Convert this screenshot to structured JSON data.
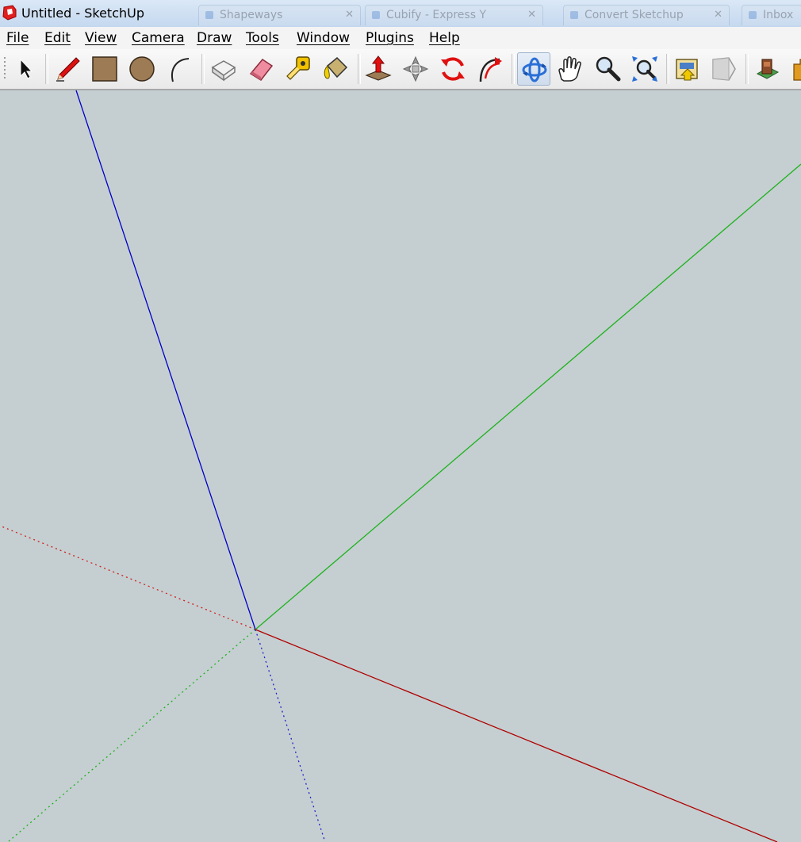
{
  "window": {
    "title": "Untitled - SketchUp",
    "background_tabs": [
      {
        "label": "Shapeways"
      },
      {
        "label": "Cubify - Express Y"
      },
      {
        "label": "Convert Sketchup"
      },
      {
        "label": "Inbox"
      }
    ]
  },
  "menu": {
    "items": [
      {
        "label": "File"
      },
      {
        "label": "Edit"
      },
      {
        "label": "View"
      },
      {
        "label": "Camera"
      },
      {
        "label": "Draw"
      },
      {
        "label": "Tools"
      },
      {
        "label": "Window"
      },
      {
        "label": "Plugins"
      },
      {
        "label": "Help"
      }
    ]
  },
  "toolbar": {
    "tools": [
      {
        "icon": "select-arrow-icon",
        "active": false
      },
      {
        "icon": "pencil-line-icon",
        "active": false
      },
      {
        "icon": "rectangle-icon",
        "active": false
      },
      {
        "icon": "circle-icon",
        "active": false
      },
      {
        "icon": "arc-icon",
        "active": false
      },
      {
        "icon": "make-component-icon",
        "active": false
      },
      {
        "icon": "eraser-icon",
        "active": false
      },
      {
        "icon": "tape-measure-icon",
        "active": false
      },
      {
        "icon": "paint-bucket-icon",
        "active": false
      },
      {
        "icon": "push-pull-icon",
        "active": false
      },
      {
        "icon": "move-icon",
        "active": false
      },
      {
        "icon": "rotate-icon",
        "active": false
      },
      {
        "icon": "follow-me-icon",
        "active": false
      },
      {
        "icon": "orbit-icon",
        "active": true
      },
      {
        "icon": "pan-hand-icon",
        "active": false
      },
      {
        "icon": "zoom-icon",
        "active": false
      },
      {
        "icon": "zoom-extents-icon",
        "active": false
      },
      {
        "icon": "get-models-icon",
        "active": false
      },
      {
        "icon": "share-model-icon",
        "active": false
      },
      {
        "icon": "extension-warehouse-icon",
        "active": false
      },
      {
        "icon": "get-photo-texture-icon",
        "active": false
      }
    ]
  },
  "colors": {
    "canvas_background": "#c5cfd1",
    "axis_red": "#b00000",
    "axis_green": "#1db21d",
    "axis_blue": "#0000c8",
    "orbit_active": "#2a6fd6"
  }
}
